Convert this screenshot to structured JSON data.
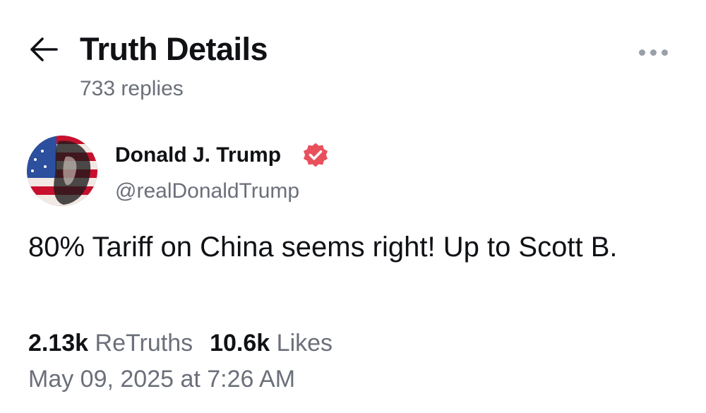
{
  "header": {
    "title": "Truth Details",
    "replies": "733 replies",
    "back_icon": "arrow-left-icon",
    "more_icon": "more-horizontal-icon"
  },
  "author": {
    "name": "Donald J. Trump",
    "handle": "@realDonaldTrump",
    "verified_icon": "verified-badge-icon",
    "verified_color": "#e8505b"
  },
  "post": {
    "text": "80% Tariff on China seems right! Up to Scott B."
  },
  "stats": {
    "retruths_count": "2.13k",
    "retruths_label": "ReTruths",
    "likes_count": "10.6k",
    "likes_label": "Likes"
  },
  "timestamp": "May 09, 2025 at 7:26 AM",
  "colors": {
    "text": "#0f1115",
    "muted": "#6b6f7a",
    "background": "#ffffff"
  }
}
